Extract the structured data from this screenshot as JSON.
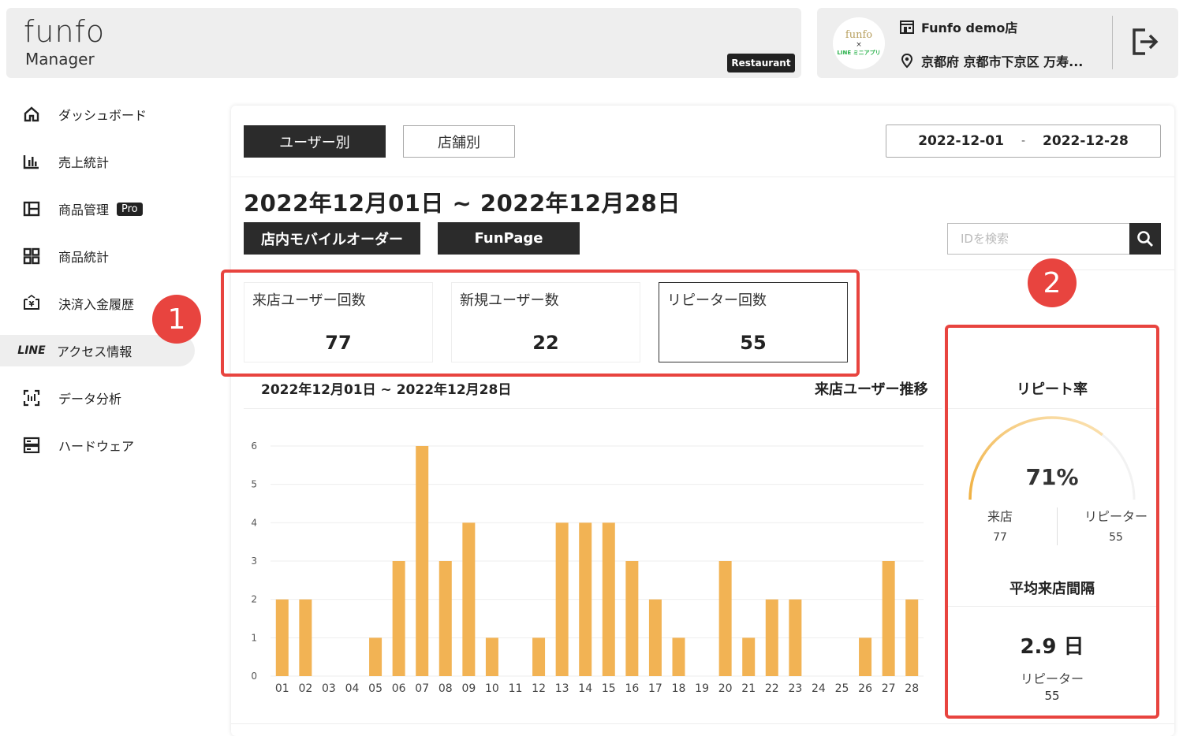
{
  "header": {
    "logo_main": "funfo",
    "logo_sub": "Manager",
    "category_badge": "Restaurant",
    "store_logo": {
      "line1": "funfo",
      "line2": "×",
      "line3": "LINE ミニアプリ"
    },
    "store_name": "Funfo demo店",
    "store_address": "京都府 京都市下京区 万寿..."
  },
  "sidebar": {
    "items": [
      {
        "label": "ダッシュボード",
        "icon": "home-icon"
      },
      {
        "label": "売上統計",
        "icon": "bar-chart-icon"
      },
      {
        "label": "商品管理",
        "icon": "layout-icon",
        "badge": "Pro"
      },
      {
        "label": "商品統計",
        "icon": "grid-icon"
      },
      {
        "label": "決済入金履歴",
        "icon": "payment-icon"
      },
      {
        "label": "アクセス情報",
        "icon": "line-icon",
        "icon_text": "LINE",
        "active": true
      },
      {
        "label": "データ分析",
        "icon": "scan-icon"
      },
      {
        "label": "ハードウェア",
        "icon": "server-icon"
      }
    ]
  },
  "annotations": {
    "marker1": "1",
    "marker2": "2"
  },
  "main": {
    "tabs": {
      "by_user": "ユーザー別",
      "by_store": "店舗別"
    },
    "date_from": "2022-12-01",
    "date_sep": "-",
    "date_to": "2022-12-28",
    "range_title": "2022年12月01日 ~ 2022年12月28日",
    "source_buttons": {
      "mobile_order": "店内モバイルオーダー",
      "funpage": "FunPage"
    },
    "search_placeholder": "IDを検索",
    "stats": [
      {
        "label": "来店ユーザー回数",
        "value": "77"
      },
      {
        "label": "新規ユーザー数",
        "value": "22"
      },
      {
        "label": "リピーター回数",
        "value": "55"
      }
    ],
    "chart_heading": "2022年12月01日 ~ 2022年12月28日",
    "chart_subheading": "来店ユーザー推移"
  },
  "repeat_card": {
    "title": "リピート率",
    "rate_text": "71%",
    "rate_fraction": 0.71,
    "visit_label": "来店",
    "visit_value": "77",
    "repeater_label": "リピーター",
    "repeater_value": "55",
    "interval_title": "平均来店間隔",
    "interval_value": "2.9 日",
    "interval_sub_label": "リピーター",
    "interval_sub_value": "55"
  },
  "colors": {
    "bar": "#f2b354",
    "accent_red": "#e8443f",
    "dark": "#2b2b2b"
  },
  "chart_data": {
    "type": "bar",
    "categories": [
      "01",
      "02",
      "03",
      "04",
      "05",
      "06",
      "07",
      "08",
      "09",
      "10",
      "11",
      "12",
      "13",
      "14",
      "15",
      "16",
      "17",
      "18",
      "19",
      "20",
      "21",
      "22",
      "23",
      "24",
      "25",
      "26",
      "27",
      "28"
    ],
    "values": [
      2,
      2,
      0,
      0,
      1,
      3,
      6,
      3,
      4,
      1,
      0,
      1,
      4,
      4,
      4,
      3,
      2,
      1,
      0,
      3,
      1,
      2,
      2,
      0,
      0,
      1,
      3,
      2
    ],
    "yticks": [
      "0",
      "1",
      "2",
      "3",
      "4",
      "5",
      "6"
    ],
    "ylim": [
      0,
      6
    ],
    "grid": true
  }
}
